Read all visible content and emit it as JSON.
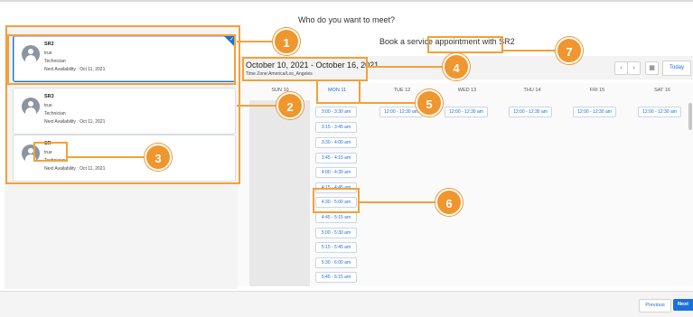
{
  "header": {
    "title": "Who do you want to meet?"
  },
  "book": {
    "title": "Book a service appointment with SR2"
  },
  "resources": [
    {
      "name": "SR2",
      "line1": "true",
      "line2": "Technician",
      "line3": "Next Availability : Oct 11, 2021"
    },
    {
      "name": "SR3",
      "line1": "true",
      "line2": "Technician",
      "line3": "Next Availability : Oct 11, 2021"
    },
    {
      "name": "SR",
      "line1": "true",
      "line2": "Technician",
      "line3": "Next Availability : Oct 11, 2021"
    }
  ],
  "calendar": {
    "date_range": "October 10, 2021 - October 16, 2021",
    "timezone": "Time Zone:America/Los_Angeles",
    "today_label": "Today",
    "days": [
      "SUN 10",
      "MON 11",
      "TUE 12",
      "WED 13",
      "THU 14",
      "FRI 15",
      "SAT 16"
    ],
    "monday_slots": [
      "3:00 - 3:30 am",
      "3:15 - 3:45 am",
      "3:30 - 4:00 am",
      "3:45 - 4:15 am",
      "4:00 - 4:30 am",
      "4:15 - 4:45 am",
      "4:30 - 5:00 am",
      "4:45 - 5:15 am",
      "5:00 - 5:30 am",
      "5:15 - 5:45 am",
      "5:30 - 6:00 am",
      "5:45 - 6:15 am"
    ],
    "other_day_slot": "12:00 - 12:30 am"
  },
  "footer": {
    "previous_label": "Previous",
    "next_label": "Next"
  },
  "callouts": [
    "1",
    "2",
    "3",
    "4",
    "5",
    "6",
    "7"
  ],
  "colors": {
    "accent": "#1b6fd6",
    "annotation": "#f0962e"
  }
}
